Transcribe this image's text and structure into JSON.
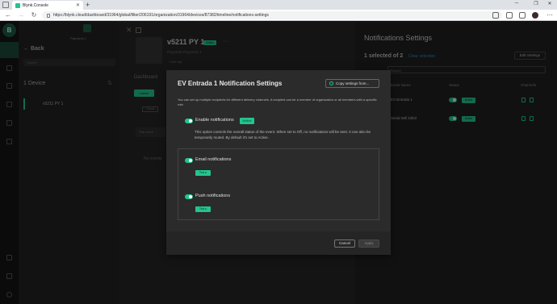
{
  "browser": {
    "tab_title": "Blynk.Console",
    "tab_close": "✕",
    "new_tab": "+",
    "url": "https://blynk.cloud/dashboard/31964/global/filter/206191/organization/31964/devices/87382/timeline/notifications-settings",
    "minimize": "─",
    "maximize": "❐",
    "close": "✕",
    "back": "←",
    "forward": "→",
    "reload": "↻",
    "menu": "⋯"
  },
  "rail": {
    "logo": "B"
  },
  "sidebar": {
    "org_name": "Paycards 1",
    "back_label": "← Back",
    "search_placeholder": "Search",
    "device_count": "1 Device",
    "sort_icon": "⇅",
    "device_item": "v5211 PY 1"
  },
  "main": {
    "close": "✕",
    "device_title": "v5211 PY 1",
    "device_status": "Online",
    "device_menu": "···",
    "device_meta": "Paycards   Paycards 1",
    "add_tag": "+ Add tag",
    "dashboard_label": "Dashboard",
    "live_button": "Latest",
    "filter_pill": "Critical",
    "event_row": "The event",
    "no_events": "No events"
  },
  "notif_panel": {
    "title": "Notifications Settings",
    "selected_count": "1 selected of 2",
    "clear_selection": "Clear selection",
    "edit_settings": "Edit Settings",
    "search_placeholder": "Search",
    "headers": {
      "name": "Event Name",
      "status": "Status",
      "channels": "Channels"
    },
    "rows": [
      {
        "name": "EV Entrada 1",
        "status": "Active"
      },
      {
        "name": "Serial Wifi Débil",
        "status": "Active"
      }
    ]
  },
  "modal": {
    "title": "EV Entrada 1 Notification Settings",
    "copy_button": "Copy settings from...",
    "description": "You can set up multiple recipients for different delivery channels. A recipient can be a member of organization or all members with a specific role.",
    "enable_label": "Enable notifications",
    "enable_badge": "Active",
    "enable_description": "This option controls the overall status of the event. When set to Off, no notifications will be sent. It can also be temporarily muted. By default it's set to Active.",
    "email_label": "Email notifications",
    "email_test": "Test ▸",
    "push_label": "Push notifications",
    "push_test": "Test ▸",
    "cancel": "Cancel",
    "apply": "Apply"
  },
  "colors": {
    "accent": "#23c48e",
    "link": "#2b8cc4",
    "modal_bg": "#2b2b2b"
  }
}
